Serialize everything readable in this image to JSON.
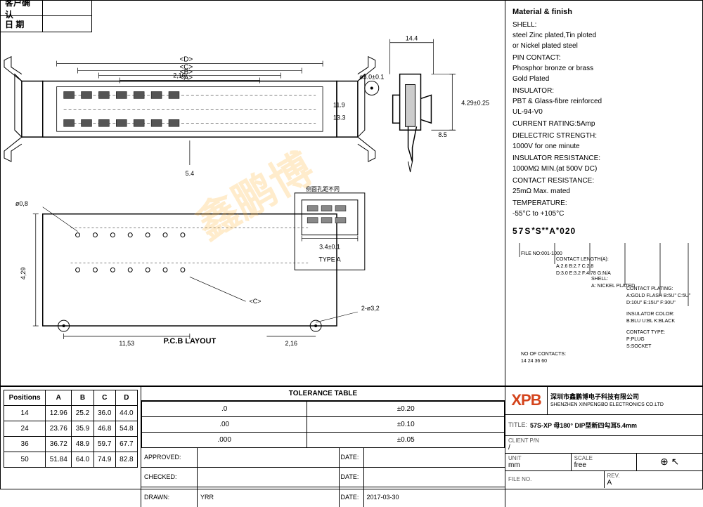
{
  "header": {
    "customer_confirm": "客户确认",
    "date_label": "日 期",
    "date_value": ""
  },
  "spec": {
    "material_finish_title": "Material & finish",
    "shell_label": "SHELL:",
    "shell_value": "steel Zinc plated,Tin ploted",
    "shell_value2": "or Nickel plated steel",
    "pin_label": "PIN CONTACT:",
    "pin_value": "Phosphor bronze or brass",
    "pin_value2": "Gold Plated",
    "insulator_label": "INSULATOR:",
    "insulator_value": "PBT & Glass-fibre reinforced",
    "insulator_value2": "UL-94-V0",
    "current_label": "CURRENT RATING:",
    "current_value": "5Amp",
    "dielectric_label": "DIELECTRIC STRENGTH:",
    "dielectric_value": "1000V for one minute",
    "resistance_label": "INSULATOR RESISTANCE:",
    "resistance_value": "1000MΩ MIN.(at 500V DC)",
    "contact_res_label": "CONTACT RESISTANCE:",
    "contact_res_value": "25mΩ Max. mated",
    "temp_label": "TEMPERATURE:",
    "temp_value": "-55°C to +105°C"
  },
  "part_number": {
    "code": "57S * S ** A * 020",
    "file_no_label": "FILE NO:",
    "file_no_value": "001-1000",
    "contact_length_label": "CONTACT LENGTHO(A):",
    "contact_length_a": "A:2.6",
    "contact_length_b": "B:2.7",
    "contact_length_c": "C:2.8",
    "contact_length_d": "D:3.0",
    "contact_length_e": "E:3.2",
    "contact_length_f": "F:4.78",
    "contact_length_g": "G:N/A",
    "shell_label": "SHELL:",
    "shell_a": "A: NICKEL PLATED",
    "contact_plating_label": "CONTACT PLATING:",
    "plating_a": "A:GOLD FLASH",
    "plating_b": "B:5U\"",
    "plating_c": "C:5U\"",
    "plating_d": "D:10U\"",
    "plating_e": "E:15U\"",
    "plating_f": "F:30U\"",
    "insulator_color_label": "INSULATOR COLOR:",
    "insulator_b": "B:BLU",
    "insulator_u": "U:BL",
    "insulator_k": "K:BLACK",
    "contact_type_label": "CONTACT TYPE:",
    "contact_p": "P:PLUG",
    "contact_s": "S:SOCKET",
    "contacts_label": "NO OF CONTACTS:",
    "contacts_values": "14  24  36  60"
  },
  "dimensions": {
    "d_label": "<D>",
    "c_label": "<C>",
    "b_label": "<B>",
    "a_label": "<A>",
    "dim_3_0": "ø3.0±0.1",
    "dim_4_29": "4.29±0.25",
    "dim_14_4": "14.4",
    "dim_2_16": "2,16",
    "dim_11_9": "11.9",
    "dim_13_3": "13.3",
    "dim_8_5": "8.5",
    "dim_5_4": "5.4",
    "dim_3_4": "3.4±0.1",
    "dim_pcb_2_16": "2,16",
    "dim_pcb_4_29": "4,29",
    "dim_pcb_11_53": "11,53",
    "dim_pcb_0_8": "ø0,8",
    "dim_pcb_3_2": "2-ø3,2",
    "pcb_layout_label": "P.C.B LAYOUT",
    "type_label": "TYPE A"
  },
  "tolerance_table": {
    "title": "TOLERANCE TABLE",
    "headers": [
      "",
      ""
    ],
    "rows": [
      [
        ".0",
        "±0.20"
      ],
      [
        ".00",
        "±0.10"
      ],
      [
        ".000",
        "±0.05"
      ]
    ]
  },
  "position_table": {
    "headers": [
      "Positions",
      "A",
      "B",
      "C",
      "D"
    ],
    "rows": [
      [
        "14",
        "12.96",
        "25.2",
        "36.0",
        "44.0"
      ],
      [
        "24",
        "23.76",
        "35.9",
        "46.8",
        "54.8"
      ],
      [
        "36",
        "36.72",
        "48.9",
        "59.7",
        "67.7"
      ],
      [
        "50",
        "51.84",
        "64.0",
        "74.9",
        "82.8"
      ]
    ]
  },
  "approval": {
    "approved_label": "APPROVED:",
    "approved_value": "",
    "date_label": "DATE:",
    "date_value": "",
    "checked_label": "CHECKED:",
    "checked_value": "",
    "checked_date": "",
    "drawn_label": "DRAWN:",
    "drawn_value": "YRR",
    "drawn_date": "2017-03-30"
  },
  "title_block": {
    "company_cn": "深圳市鑫鹏博电子科技有限公司",
    "company_en": "SHENZHEN XINPENGBO ELECTRONICS CO.LTD",
    "logo": "XPB",
    "title_label": "TITLE:",
    "title_value": "57S-XP 母180° DIP型新四勾耳5.4mm",
    "client_pn_label": "CLIENT P/N",
    "client_pn_value": "/",
    "unit_label": "UNIT",
    "unit_value": "mm",
    "scale_label": "SCALE",
    "scale_value": "free",
    "file_no_label": "FILE NO.",
    "file_no_value": "",
    "rev_label": "REV.",
    "rev_value": "A"
  },
  "watermark": "鑫鹏博"
}
